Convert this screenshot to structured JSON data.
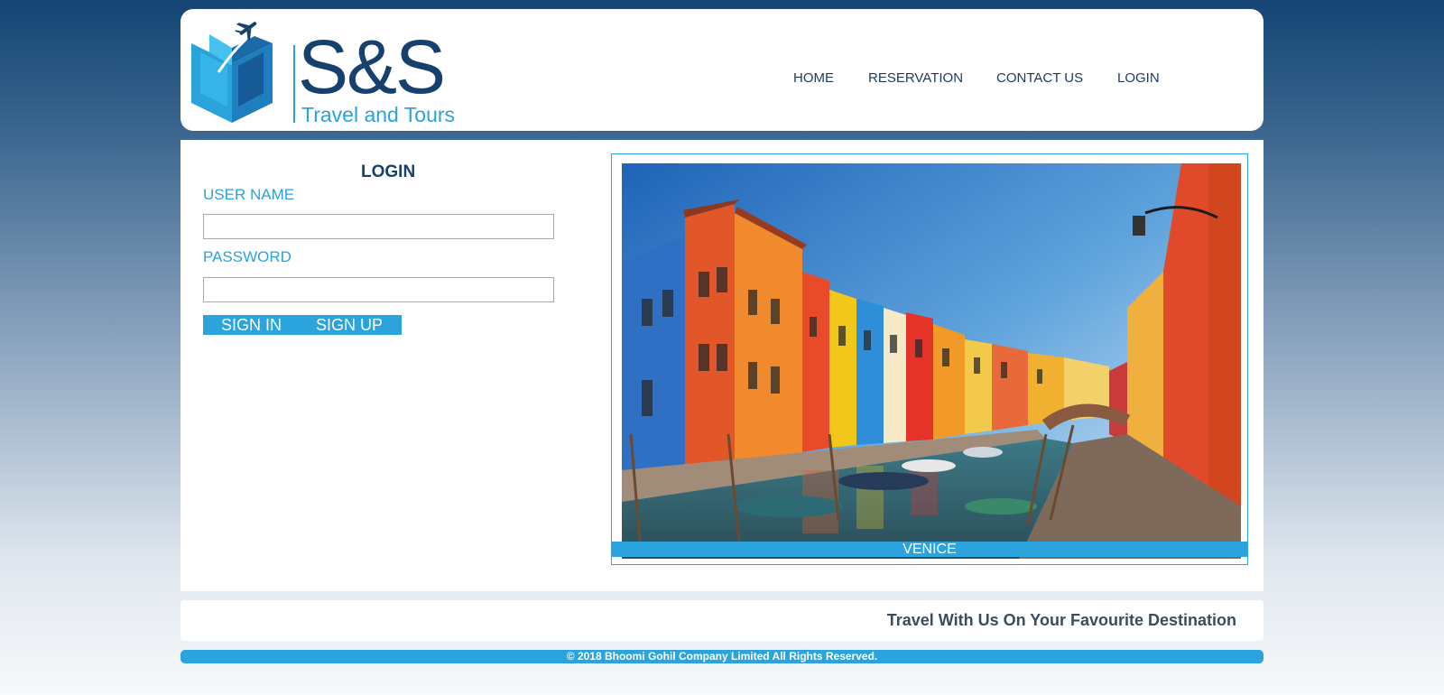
{
  "logo": {
    "brand": "S&S",
    "tagline": "Travel and Tours"
  },
  "nav": {
    "home": "HOME",
    "reservation": "RESERVATION",
    "contact": "CONTACT US",
    "login": "LOGIN"
  },
  "login": {
    "title": "LOGIN",
    "username_label": "USER NAME",
    "username_value": "",
    "password_label": "PASSWORD",
    "password_value": "",
    "sign_in": "SIGN IN",
    "sign_up": "SIGN UP"
  },
  "slideshow": {
    "caption": "VENICE"
  },
  "tagline": "Travel With Us On Your Favourite Destination",
  "footer": "© 2018 Bhoomi Gohil Company Limited All Rights Reserved.",
  "colors": {
    "accent": "#2ba3dc",
    "navy": "#16406d",
    "page_top": "#144574"
  }
}
